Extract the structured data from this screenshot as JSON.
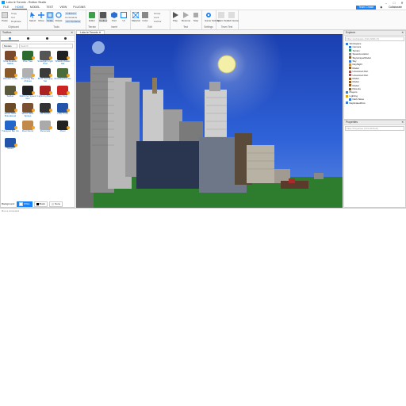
{
  "window": {
    "title": "Lobo le Toronto - Roblox Studio"
  },
  "menu": {
    "items": [
      "FILE",
      "HOME",
      "MODEL",
      "TEST",
      "VIEW",
      "PLUGINS"
    ],
    "active_index": 1,
    "right_buttons": [
      "Team Create",
      "Avatar",
      "Collaborate"
    ]
  },
  "ribbon": {
    "clipboard": {
      "label": "Clipboard",
      "paste": "Paste",
      "copy": "Copy",
      "cut": "Cut",
      "duplicate": "Duplicate"
    },
    "tools": {
      "label": "Tools",
      "select": "Select",
      "move": "Move",
      "scale": "Scale",
      "rotate": "Rotate",
      "collisions": "Collisions",
      "constraints": "Constraints",
      "join_surfaces": "Join Surfaces"
    },
    "terrain": {
      "label": "Terrain",
      "editor": "Editor"
    },
    "insert": {
      "label": "Insert",
      "toolbox": "Toolbox",
      "part": "Part",
      "ui": "UI"
    },
    "edit": {
      "label": "Edit",
      "material": "Material",
      "color": "Color",
      "group": "Group",
      "lock": "Lock",
      "anchor": "Anchor"
    },
    "test": {
      "label": "Test",
      "play": "Play",
      "resume": "Resume",
      "stop": "Stop"
    },
    "settings": {
      "label": "Settings",
      "game_settings": "Game Settings"
    },
    "team_test": {
      "label": "Team Test",
      "team_test": "Team Test",
      "exit_game": "Exit Game"
    }
  },
  "toolbox": {
    "title": "Toolbox",
    "category": "Models",
    "search_placeholder": "Search",
    "items": [
      {
        "name": "Ultra-Realistic Stable",
        "color": "#7a4a2a"
      },
      {
        "name": "Pine Tree",
        "color": "#2e6b2e"
      },
      {
        "name": "Streetlight Light Post",
        "color": "#555555"
      },
      {
        "name": "Wheels Classic Hat",
        "color": "#222222"
      },
      {
        "name": "Wooden Crate",
        "color": "#8a5a2b"
      },
      {
        "name": "Proximity Bar Chimes",
        "color": "#b0b0b0"
      },
      {
        "name": "Birds Swinging Set",
        "color": "#3a3a3a"
      },
      {
        "name": "Shooting Zombie",
        "color": "#4a6b3a"
      },
      {
        "name": "Soldier",
        "color": "#5a5a3a"
      },
      {
        "name": "Mobil Car Speed Gun",
        "color": "#222222"
      },
      {
        "name": "Lightning Barrel",
        "color": "#aa2222"
      },
      {
        "name": "Stop Sign",
        "color": "#cc2222"
      },
      {
        "name": "Wood Table Brandwood",
        "color": "#6b4a2a"
      },
      {
        "name": "Wood Table Sprays",
        "color": "#7a5030"
      },
      {
        "name": "Off Pocket",
        "color": "#333333"
      },
      {
        "name": "Lolly Truck",
        "color": "#2255aa"
      },
      {
        "name": "Transport Bar Inn",
        "color": "#2266cc"
      },
      {
        "name": "Root Donut",
        "color": "#c28a4a"
      },
      {
        "name": "Personals",
        "color": "#aaaaaa"
      },
      {
        "name": "Pistol",
        "color": "#222222"
      },
      {
        "name": "Sword",
        "color": "#2255aa"
      }
    ],
    "background": {
      "label": "Background:",
      "options": [
        {
          "label": "White",
          "swatch": "#ffffff",
          "selected": true
        },
        {
          "label": "Black",
          "swatch": "#000000",
          "selected": false
        },
        {
          "label": "None",
          "swatch": "#dddddd",
          "selected": false
        }
      ]
    }
  },
  "viewport": {
    "tab": "Lobo le Toronto"
  },
  "explorer": {
    "title": "Explorer",
    "filter_placeholder": "Filter workspace (Ctrl+Shift+X)",
    "items": [
      {
        "label": "Workspace",
        "indent": 0,
        "color": "#3a7bd5"
      },
      {
        "label": "Camera",
        "indent": 1,
        "color": "#3a7bd5"
      },
      {
        "label": "Terrain",
        "indent": 1,
        "color": "#2e8b57"
      },
      {
        "label": "SpawnLocation",
        "indent": 1,
        "color": "#888888"
      },
      {
        "label": "SkyscraperModel",
        "indent": 1,
        "color": "#8a5a2b"
      },
      {
        "label": "Sky",
        "indent": 1,
        "color": "#3a7bd5"
      },
      {
        "label": "DayNight",
        "indent": 1,
        "color": "#c28a4a"
      },
      {
        "label": "Model",
        "indent": 1,
        "color": "#8a5a2b"
      },
      {
        "label": "Unionized Part",
        "indent": 1,
        "color": "#b05050"
      },
      {
        "label": "Unionized Part",
        "indent": 1,
        "color": "#b05050"
      },
      {
        "label": "Model",
        "indent": 1,
        "color": "#8a5a2b"
      },
      {
        "label": "Model",
        "indent": 1,
        "color": "#8a5a2b"
      },
      {
        "label": "Model",
        "indent": 1,
        "color": "#8a5a2b"
      },
      {
        "label": "Parents",
        "indent": 1,
        "color": "#8a5a2b"
      },
      {
        "label": "Players",
        "indent": 0,
        "color": "#3a7bd5"
      },
      {
        "label": "Lighting",
        "indent": 0,
        "color": "#d9a520"
      },
      {
        "label": "Dark Skies",
        "indent": 1,
        "color": "#3a7bd5"
      },
      {
        "label": "ReplicatedFirst",
        "indent": 0,
        "color": "#3a7bd5"
      }
    ]
  },
  "properties": {
    "title": "Properties",
    "filter_placeholder": "Filter Properties (Ctrl+Shift+P)"
  },
  "command_bar": {
    "placeholder": "Run a command"
  }
}
